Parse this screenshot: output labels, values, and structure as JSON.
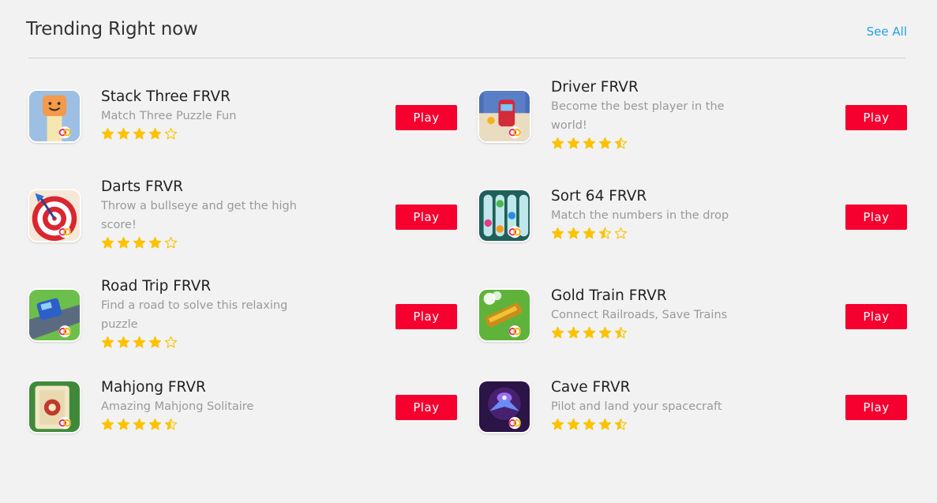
{
  "section": {
    "title": "Trending Right now",
    "see_all": "See All"
  },
  "play_label": "Play",
  "colors": {
    "accent": "#1fa3e6",
    "play": "#f5002f",
    "star": "#fcc200"
  },
  "games": [
    {
      "name": "Stack Three FRVR",
      "desc": "Match Three Puzzle Fun",
      "rating": 4,
      "icon": "stack-three-icon"
    },
    {
      "name": "Driver FRVR",
      "desc": "Become the best player in the world!",
      "rating": 4.5,
      "icon": "driver-car-icon"
    },
    {
      "name": "Darts FRVR",
      "desc": "Throw a bullseye and get the high score!",
      "rating": 4,
      "icon": "darts-icon"
    },
    {
      "name": "Sort 64 FRVR",
      "desc": "Match the numbers in the drop",
      "rating": 3.5,
      "icon": "sort-64-icon"
    },
    {
      "name": "Road Trip FRVR",
      "desc": "Find a road to solve this relaxing puzzle",
      "rating": 4,
      "icon": "road-trip-car-icon"
    },
    {
      "name": "Gold Train FRVR",
      "desc": "Connect Railroads, Save Trains",
      "rating": 4.5,
      "icon": "gold-train-icon"
    },
    {
      "name": "Mahjong FRVR",
      "desc": "Amazing Mahjong Solitaire",
      "rating": 4.5,
      "icon": "mahjong-tile-icon"
    },
    {
      "name": "Cave FRVR",
      "desc": "Pilot and land your spacecraft",
      "rating": 4.5,
      "icon": "spaceship-icon"
    }
  ]
}
